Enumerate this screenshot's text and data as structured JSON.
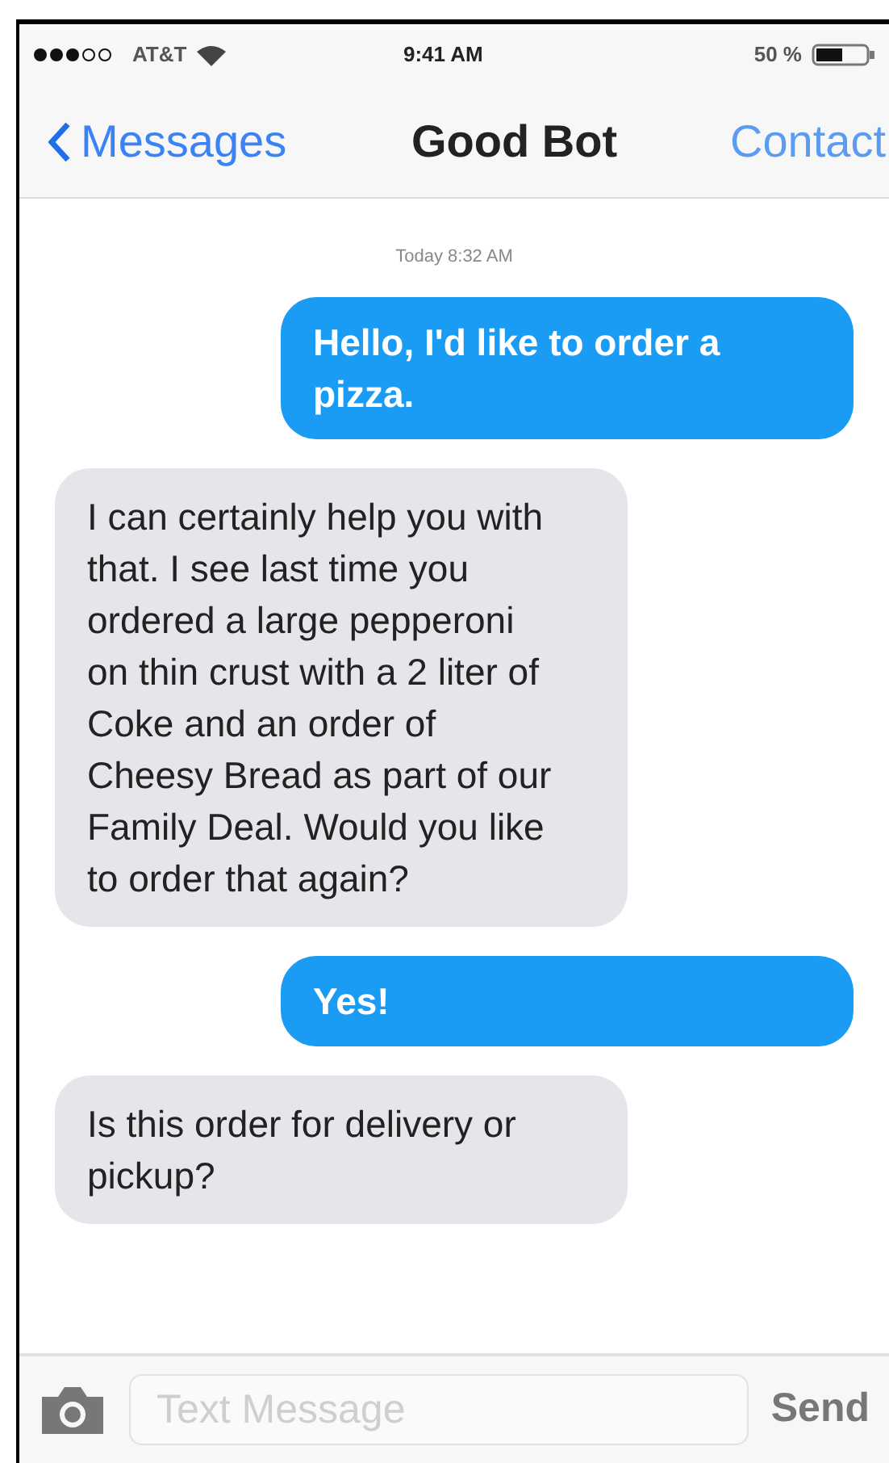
{
  "status_bar": {
    "carrier": "AT&T",
    "time": "9:41 AM",
    "battery": "50 %"
  },
  "nav": {
    "back": "Messages",
    "title": "Good Bot",
    "action": "Contact"
  },
  "timestamp": "Today 8:32 AM",
  "messages": [
    {
      "kind": "sent",
      "text": "Hello, I'd like to order a pizza."
    },
    {
      "kind": "received",
      "text": "I can certainly help you with that. I see last time you ordered a large pepperoni on thin crust with a 2 liter of Coke and an order of Cheesy Bread as part of our Family Deal. Would you like to order that again?"
    },
    {
      "kind": "sent",
      "text": "Yes!"
    },
    {
      "kind": "received",
      "text": "Is this order for delivery or pickup?"
    }
  ],
  "composer": {
    "placeholder": "Text Message",
    "send": "Send"
  }
}
